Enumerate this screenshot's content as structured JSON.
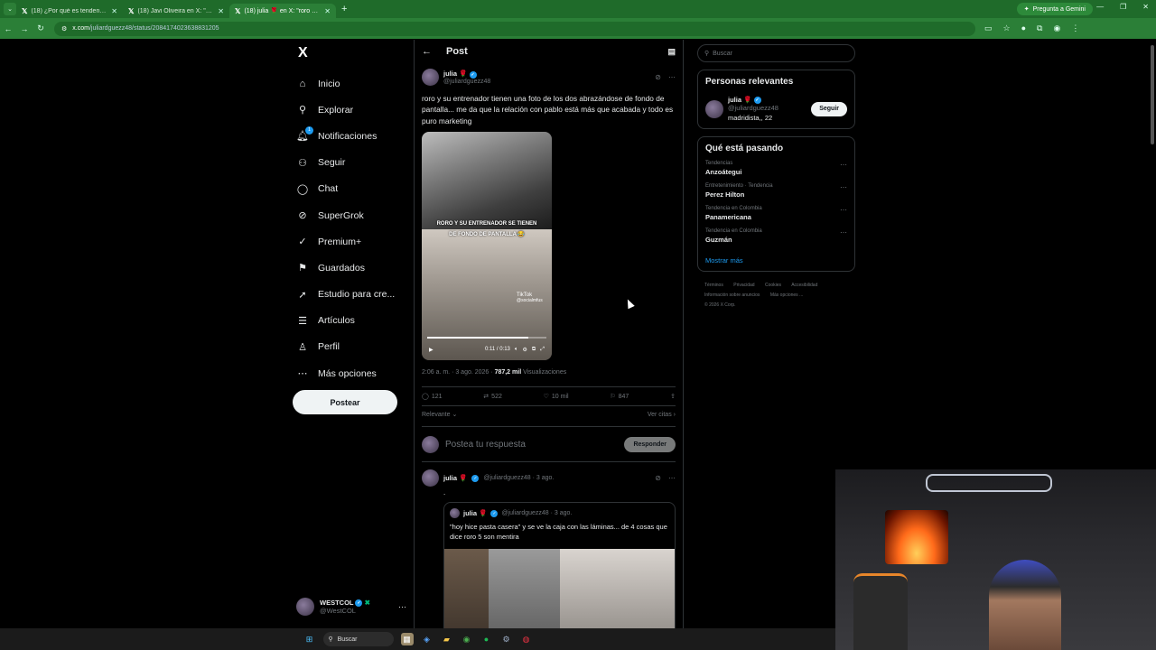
{
  "browser": {
    "tabs": [
      {
        "label": "(18) ¿Por qué es tendencia en N",
        "active": false
      },
      {
        "label": "(18) Javi Oliveira en X: \"Roro n",
        "active": false
      },
      {
        "label": "(18) julia 🌹 en X: \"roro y su en",
        "active": true
      }
    ],
    "gemini_label": "Pregunta a Gemini",
    "url_domain": "x.com",
    "url_path": "/juliardguezz48/status/2084174023638831205"
  },
  "sidebar": {
    "logo": "X",
    "items": [
      {
        "label": "Inicio",
        "icon": "home-icon"
      },
      {
        "label": "Explorar",
        "icon": "search-icon"
      },
      {
        "label": "Notificaciones",
        "icon": "bell-icon",
        "badge": "1"
      },
      {
        "label": "Seguir",
        "icon": "person-add-icon"
      },
      {
        "label": "Chat",
        "icon": "chat-icon"
      },
      {
        "label": "SuperGrok",
        "icon": "grok-icon"
      },
      {
        "label": "Premium+",
        "icon": "premium-icon"
      },
      {
        "label": "Guardados",
        "icon": "bookmark-icon"
      },
      {
        "label": "Estudio para cre...",
        "icon": "rocket-icon"
      },
      {
        "label": "Artículos",
        "icon": "articles-icon"
      },
      {
        "label": "Perfil",
        "icon": "profile-icon"
      },
      {
        "label": "Más opciones",
        "icon": "more-options-icon"
      }
    ],
    "post_button": "Postear",
    "account": {
      "name": "WESTCOL",
      "handle": "@WestCOL"
    }
  },
  "main": {
    "title": "Post",
    "post": {
      "author": "julia 🌹",
      "handle": "@juliardguezz48",
      "text": "roro y su entrenador tienen una foto de los dos abrazándose de fondo de pantalla... me da que la relación con pablo está más que acabada y todo es puro marketing",
      "video_caption_1": "RORO Y SU ENTRENADOR SE TIENEN",
      "video_caption_2": "DE FONDO DE PANTALLA 😂",
      "video_watermark": "TikTok",
      "video_watermark_handle": "@socialmfus",
      "video_time": "0:11 / 0:13",
      "video_progress": 0.85,
      "timestamp": "2:06 a. m. · 3 ago. 2026 · ",
      "views_count": "787,2 mil",
      "views_label": " Visualizaciones",
      "stats": {
        "replies": "121",
        "reposts": "522",
        "likes": "10 mil",
        "bookmarks": "847"
      }
    },
    "sort_label": "Relevante",
    "quotes_link": "Ver citas",
    "reply_placeholder": "Postea tu respuesta",
    "reply_button": "Responder",
    "reply": {
      "author": "julia 🌹",
      "handle": "@juliardguezz48 · 3 ago.",
      "text": ".",
      "quote": {
        "author": "julia 🌹",
        "handle": "@juliardguezz48 · 3 ago.",
        "text": "\"hoy hice pasta casera\" y se ve la caja con las láminas... de 4 cosas que dice roro 5 son mentira"
      }
    }
  },
  "right": {
    "search_placeholder": "Buscar",
    "relevant_title": "Personas relevantes",
    "relevant": {
      "name": "julia 🌹",
      "handle": "@juliardguezz48",
      "bio": "madridista,, 22",
      "follow": "Seguir"
    },
    "trends_title": "Qué está pasando",
    "trends": [
      {
        "context": "Tendencias",
        "name": "Anzoátegui"
      },
      {
        "context": "Entretenimiento · Tendencia",
        "name": "Perez Hilton"
      },
      {
        "context": "Tendencia en Colombia",
        "name": "Panamericana"
      },
      {
        "context": "Tendencia en Colombia",
        "name": "Guzmán"
      }
    ],
    "show_more": "Mostrar más",
    "footer": [
      "Términos",
      "Privacidad",
      "Cookies",
      "Accesibilidad",
      "Información sobre anuncios",
      "Más opciones ...",
      "© 2026 X Corp."
    ]
  },
  "taskbar": {
    "search": "Buscar"
  }
}
